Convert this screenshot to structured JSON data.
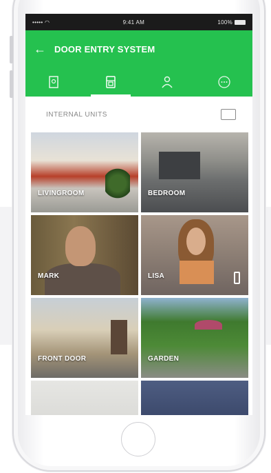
{
  "status": {
    "carrier": "••••• ◠",
    "time": "9:41 AM",
    "battery": "100%"
  },
  "appbar": {
    "back_icon": "arrow-left-icon",
    "title": "DOOR ENTRY SYSTEM"
  },
  "tabs": [
    {
      "icon": "document-icon",
      "active": false
    },
    {
      "icon": "panel-icon",
      "active": true
    },
    {
      "icon": "person-icon",
      "active": false
    },
    {
      "icon": "more-icon",
      "active": false
    }
  ],
  "section": {
    "label": "INTERNAL UNITS",
    "icon": "screen-icon"
  },
  "units": [
    {
      "label": "LIVINGROOM"
    },
    {
      "label": "BEDROOM"
    },
    {
      "label": "MARK"
    },
    {
      "label": "LISA",
      "badge": "phone-icon"
    },
    {
      "label": "FRONT DOOR"
    },
    {
      "label": "GARDEN"
    },
    {
      "label": ""
    },
    {
      "label": ""
    }
  ],
  "colors": {
    "accent": "#25c14f",
    "statusbar": "#1b1b1b"
  }
}
